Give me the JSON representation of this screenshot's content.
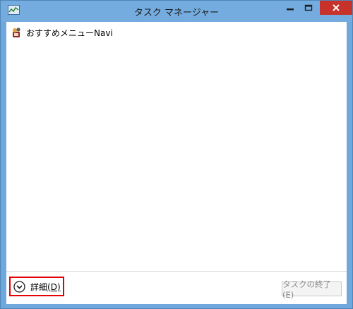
{
  "window": {
    "title": "タスク マネージャー",
    "accent_color": "#74acdf",
    "close_color": "#c7322a"
  },
  "controls": {
    "minimize_icon": "minimize-icon",
    "maximize_icon": "maximize-icon",
    "close_icon": "close-icon"
  },
  "apps": [
    {
      "name": "おすすめメニューNavi",
      "icon": "navi-app-icon"
    }
  ],
  "footer": {
    "details_label": "詳細",
    "details_shortcut": "(D)",
    "end_task_label": "タスクの終了(E)",
    "highlight_color": "#e30000"
  }
}
